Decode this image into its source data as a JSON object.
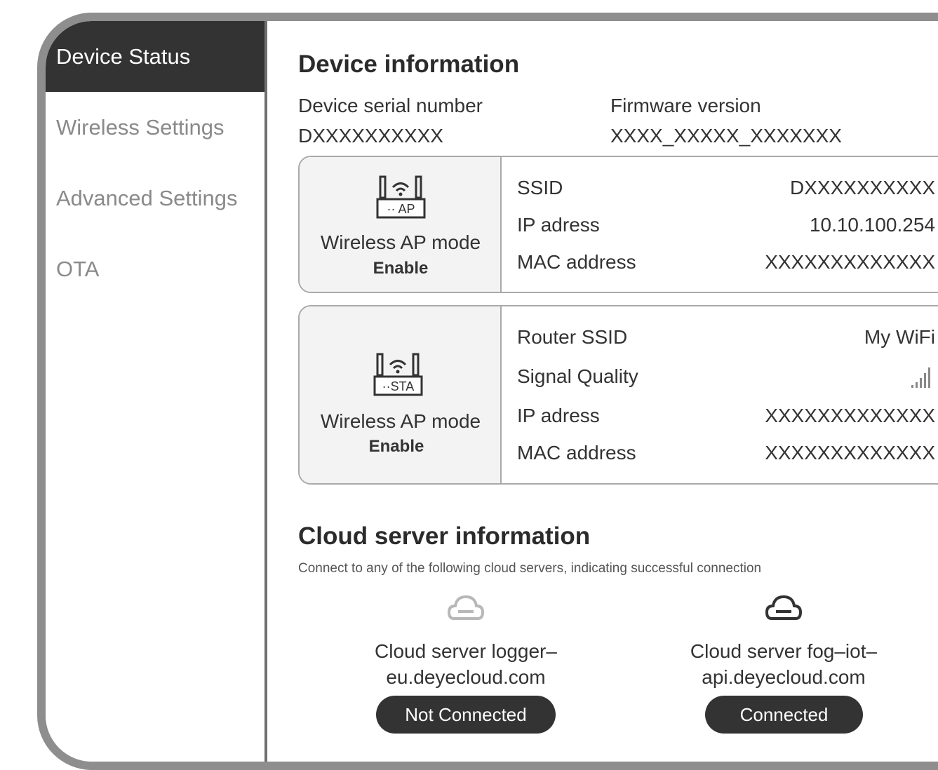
{
  "sidebar": {
    "items": [
      {
        "label": "Device Status"
      },
      {
        "label": "Wireless Settings"
      },
      {
        "label": "Advanced Settings"
      },
      {
        "label": "OTA"
      }
    ]
  },
  "device_info": {
    "title": "Device information",
    "serial_label": "Device serial number",
    "serial_value": "DXXXXXXXXXX",
    "firmware_label": "Firmware version",
    "firmware_value": "XXXX_XXXXX_XXXXXXX"
  },
  "ap_card": {
    "icon_text": "·· AP",
    "mode": "Wireless AP mode",
    "state": "Enable",
    "rows": [
      {
        "label": "SSID",
        "value": "DXXXXXXXXXX"
      },
      {
        "label": "IP adress",
        "value": "10.10.100.254"
      },
      {
        "label": "MAC address",
        "value": "XXXXXXXXXXXXX"
      }
    ]
  },
  "sta_card": {
    "icon_text": "··STA",
    "mode": "Wireless AP mode",
    "state": "Enable",
    "rows": [
      {
        "label": "Router SSID",
        "value": "My WiFi"
      },
      {
        "label": "Signal Quality",
        "value": ""
      },
      {
        "label": "IP adress",
        "value": "XXXXXXXXXXXXX"
      },
      {
        "label": "MAC address",
        "value": "XXXXXXXXXXXXX"
      }
    ],
    "signal_bars_filled": 5,
    "signal_bars_total": 5
  },
  "cloud": {
    "title": "Cloud server information",
    "subtitle": "Connect to any of the following cloud servers, indicating successful connection",
    "servers": [
      {
        "name_line1": "Cloud server logger–",
        "name_line2": "eu.deyecloud.com",
        "status": "Not Connected",
        "icon_color": "#b0b0b0"
      },
      {
        "name_line1": "Cloud server fog–iot–",
        "name_line2": "api.deyecloud.com",
        "status": "Connected",
        "icon_color": "#333333"
      }
    ]
  }
}
